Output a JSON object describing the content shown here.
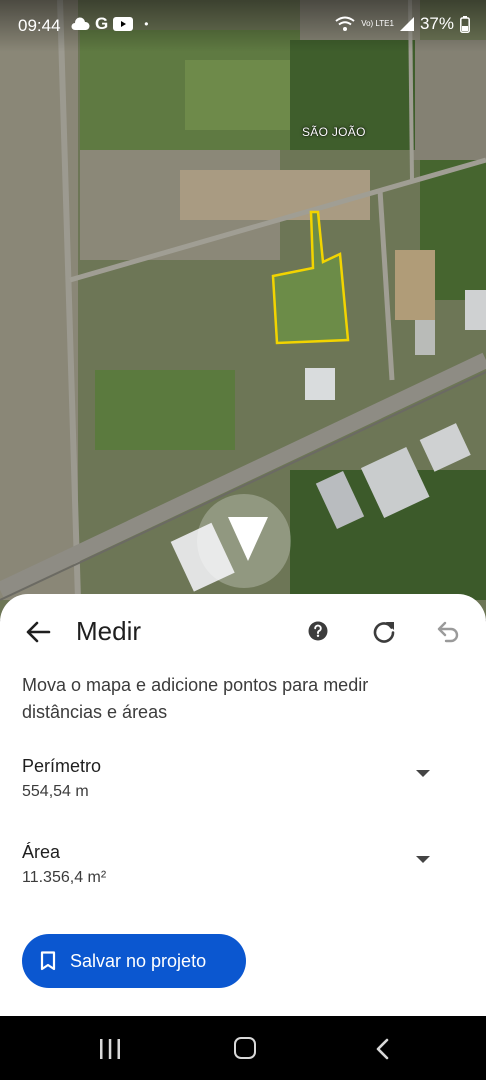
{
  "status_bar": {
    "time": "09:44",
    "g_letter": "G",
    "dot": "•",
    "network": "Vo) LTE1",
    "battery": "37%"
  },
  "map": {
    "place_label": "SÃO JOÃO",
    "icons": [
      "weather-cloud-icon",
      "youtube-icon",
      "wifi-icon",
      "signal-icon",
      "battery-icon"
    ]
  },
  "sheet": {
    "title": "Medir",
    "instructions": "Mova o mapa e adicione pontos para medir distâncias e áreas",
    "perimeter": {
      "label": "Perímetro",
      "value": "554,54 m"
    },
    "area": {
      "label": "Área",
      "value": "11.356,4 m²"
    },
    "save_label": "Salvar no projeto",
    "icons": [
      "arrow-back-icon",
      "help-icon",
      "reset-icon",
      "undo-icon",
      "bookmark-icon",
      "chevron-down-icon"
    ]
  },
  "colors": {
    "accent": "#0b57d0",
    "measure_outline": "#f2d400"
  }
}
